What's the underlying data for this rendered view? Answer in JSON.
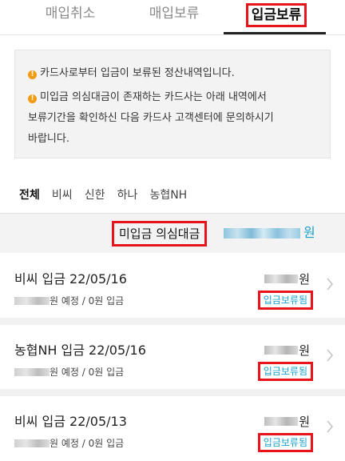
{
  "top_tabs": [
    {
      "label": "매입취소"
    },
    {
      "label": "매입보류"
    },
    {
      "label": "입금보류"
    }
  ],
  "notice": {
    "line1": "카드사로부터 입금이 보류된 정산내역입니다.",
    "line2a": "미입금 의심대금이 존재하는 카드사는 아래 내역에서",
    "line2b": "보류기간을 확인하신 다음 카드사 고객센터에 문의하시기",
    "line2c": "바랍니다."
  },
  "filters": [
    "전체",
    "비씨",
    "신한",
    "하나",
    "농협NH"
  ],
  "summary": {
    "label": "미입금 의심대금",
    "unit": "원"
  },
  "items": [
    {
      "title": "비씨 입금 22/05/16",
      "amount_unit": "원",
      "sub": "원 예정 / 0원 입금",
      "badge": "입금보류됨"
    },
    {
      "title": "농협NH 입금 22/05/16",
      "amount_unit": "원",
      "sub": "원 예정 / 0원 입금",
      "badge": "입금보류됨"
    },
    {
      "title": "비씨 입금 22/05/13",
      "amount_unit": "원",
      "sub": "원 예정 / 0원 입금",
      "badge": "입금보류됨"
    }
  ],
  "colors": {
    "highlight": "#e8141c",
    "accent": "#1aa0c8",
    "info_icon": "#f39c12"
  }
}
